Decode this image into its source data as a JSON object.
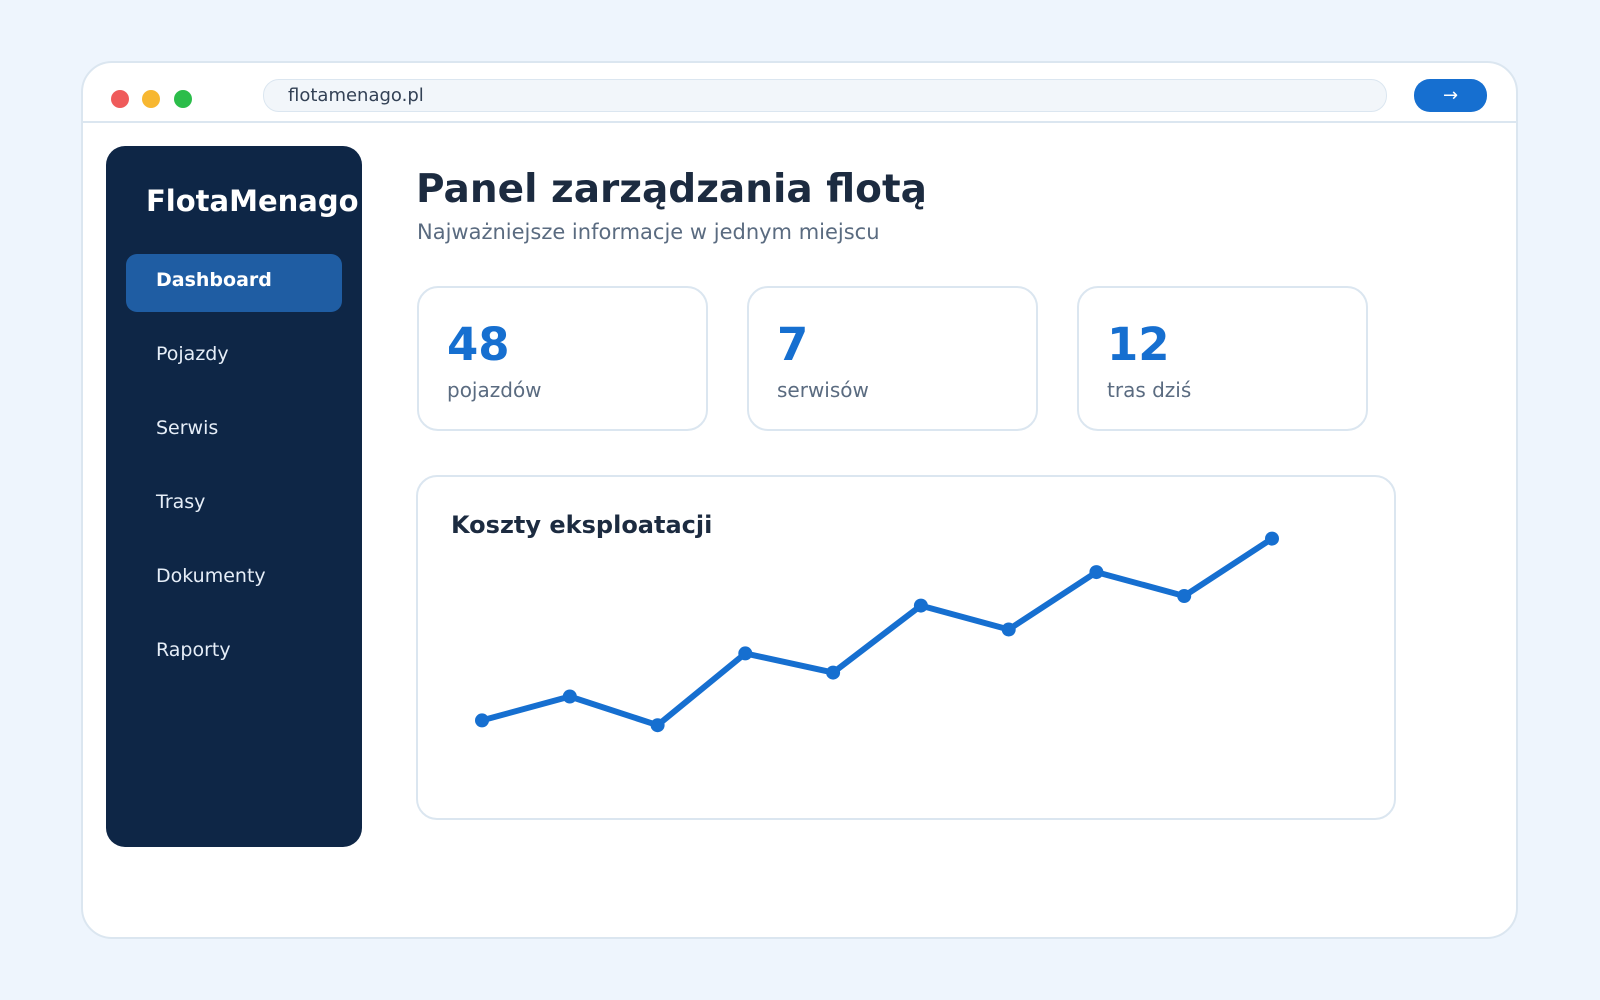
{
  "browser": {
    "url": "flotamenago.pl",
    "go_label": "→",
    "window_controls": [
      {
        "name": "close-dot-icon",
        "color": "#ef5b5b"
      },
      {
        "name": "minimize-dot-icon",
        "color": "#f7b731"
      },
      {
        "name": "maximize-dot-icon",
        "color": "#2bbd4a"
      }
    ]
  },
  "sidebar": {
    "brand": "FlotaMenago",
    "items": [
      {
        "label": "Dashboard",
        "active": true
      },
      {
        "label": "Pojazdy",
        "active": false
      },
      {
        "label": "Serwis",
        "active": false
      },
      {
        "label": "Trasy",
        "active": false
      },
      {
        "label": "Dokumenty",
        "active": false
      },
      {
        "label": "Raporty",
        "active": false
      }
    ]
  },
  "main": {
    "title": "Panel zarządzania flotą",
    "subtitle": "Najważniejsze informacje w jednym miejscu",
    "stats": [
      {
        "value": "48",
        "label": "pojazdów"
      },
      {
        "value": "7",
        "label": "serwisów"
      },
      {
        "value": "12",
        "label": "tras dziś"
      }
    ],
    "chart_title": "Koszty eksploatacji"
  },
  "colors": {
    "accent": "#166fd0",
    "sidebar_bg": "#0e2646",
    "sidebar_active": "#1f5da3",
    "page_bg": "#eef5fd"
  },
  "chart_data": {
    "type": "line",
    "title": "Koszty eksploatacji",
    "xlabel": "",
    "ylabel": "",
    "x": [
      1,
      2,
      3,
      4,
      5,
      6,
      7,
      8,
      9,
      10
    ],
    "series": [
      {
        "values": [
          16,
          21,
          15,
          30,
          26,
          40,
          35,
          47,
          42,
          54
        ]
      }
    ],
    "ylim": [
      0,
      56
    ],
    "grid": false,
    "legend": "none"
  }
}
